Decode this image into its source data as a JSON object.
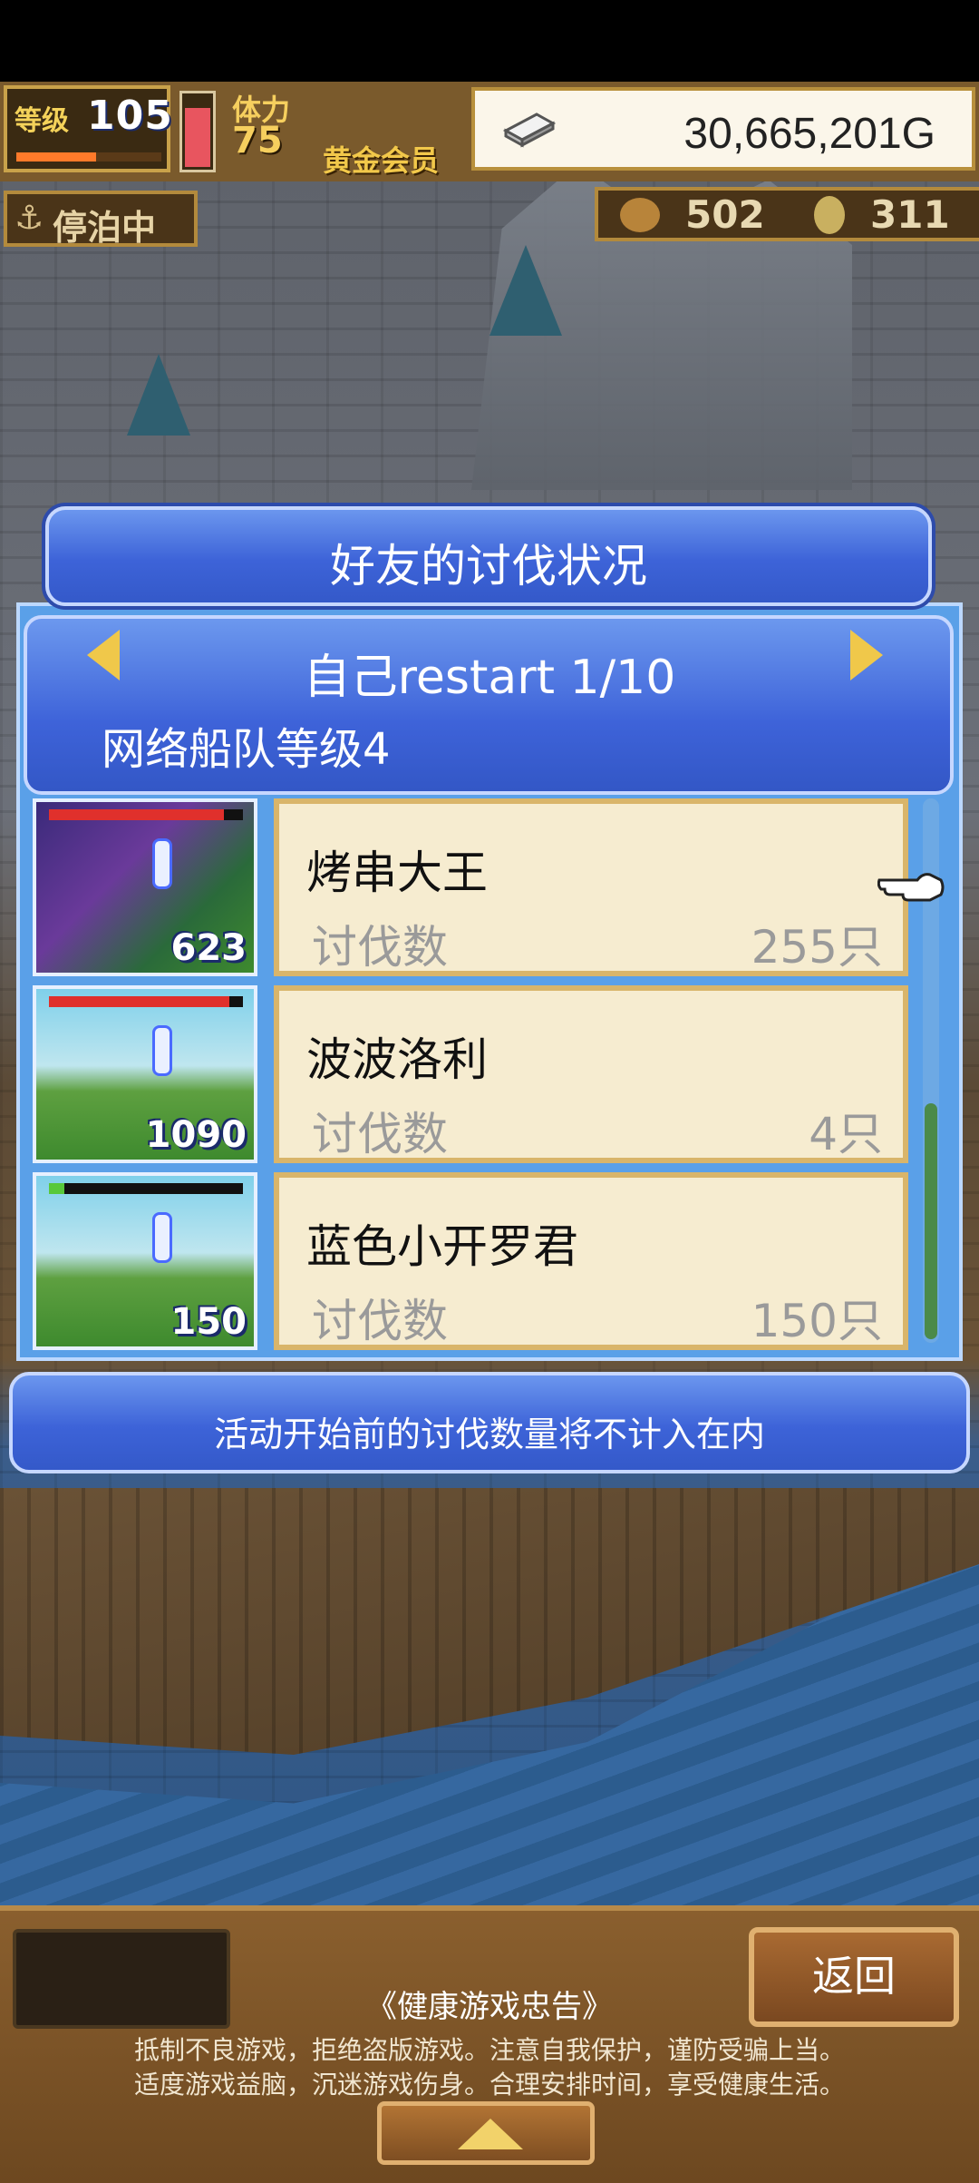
{
  "hud": {
    "level_label": "等级",
    "level_value": "105",
    "level_progress": 0.55,
    "stamina_label": "体力",
    "stamina_value": "75",
    "stamina_level": 0.85,
    "membership": "黄金会员",
    "gold": "30,665,201G",
    "status": "停泊中",
    "resource1": "502",
    "resource2": "311"
  },
  "dialog": {
    "title": "好友的讨伐状况",
    "header_name": "自己restart 1/10",
    "header_sub": "网络船队等级4",
    "rows": [
      {
        "name": "烤串大王",
        "label": "讨伐数",
        "count": "255只",
        "thumb_number": "623",
        "hp_fraction": 0.9,
        "hp_color": "#e0302c"
      },
      {
        "name": "波波洛利",
        "label": "讨伐数",
        "count": "4只",
        "thumb_number": "1090",
        "hp_fraction": 0.93,
        "hp_color": "#e0302c"
      },
      {
        "name": "蓝色小开罗君",
        "label": "讨伐数",
        "count": "150只",
        "thumb_number": "150",
        "hp_fraction": 0.08,
        "hp_color": "#58c83a"
      }
    ],
    "note": "活动开始前的讨伐数量将不计入在内"
  },
  "bottom": {
    "back_label": "返回",
    "advice_title": "《健康游戏忠告》",
    "advice_line1": "抵制不良游戏，拒绝盗版游戏。注意自我保护，谨防受骗上当。",
    "advice_line2": "适度游戏益脑，沉迷游戏伤身。合理安排时间，享受健康生活。"
  },
  "icons": {
    "anchor": "⚓",
    "silver": "silver-bar-icon",
    "pointer": "pointing-hand-icon",
    "up": "up-arrow-icon"
  }
}
